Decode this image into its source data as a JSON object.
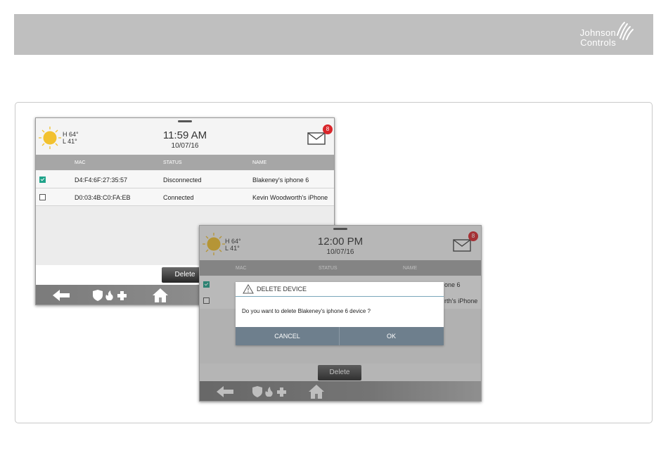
{
  "brand": {
    "line1": "Johnson",
    "line2": "Controls"
  },
  "screen1": {
    "weather": {
      "high": "H 64°",
      "low": "L 41°"
    },
    "time": "11:59 AM",
    "date": "10/07/16",
    "mail_count": "8",
    "columns": [
      "MAC",
      "STATUS",
      "NAME"
    ],
    "rows": [
      {
        "mac": "D4:F4:6F:27:35:57",
        "status": "Disconnected",
        "name": "Blakeney's iphone 6",
        "checked": true
      },
      {
        "mac": "D0:03:4B:C0:FA:EB",
        "status": "Connected",
        "name": "Kevin Woodworth's iPhone",
        "checked": false
      }
    ],
    "delete_label": "Delete"
  },
  "screen2": {
    "weather": {
      "high": "H 64°",
      "low": "L 41°"
    },
    "time": "12:00 PM",
    "date": "10/07/16",
    "mail_count": "8",
    "columns": [
      "MAC",
      "STATUS",
      "NAME"
    ],
    "row1_name_tail": "one 6",
    "row2_name_tail": "rth's iPhone",
    "delete_label": "Delete",
    "dialog": {
      "title": "DELETE DEVICE",
      "message": "Do you want to delete Blakeney's iphone 6 device ?",
      "cancel": "CANCEL",
      "ok": "OK"
    }
  },
  "colors": {
    "accent_teal": "#1fa38a",
    "badge_red": "#d9262b",
    "dialog_buttons": "#6e7f8d"
  }
}
